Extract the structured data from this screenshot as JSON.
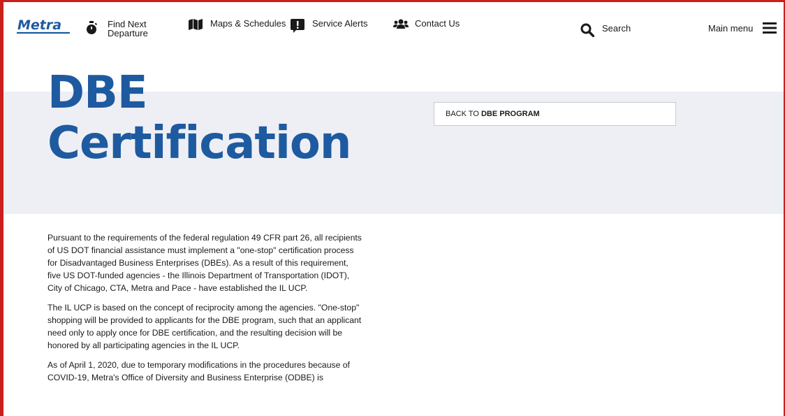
{
  "header": {
    "logo_text": "Metra",
    "nav": {
      "find_line1": "Find Next",
      "find_line2": "Departure",
      "maps": "Maps & Schedules",
      "alerts": "Service Alerts",
      "contact": "Contact Us",
      "search": "Search",
      "main_menu": "Main menu"
    }
  },
  "page": {
    "title_line1": "DBE",
    "title_line2": "Certification",
    "back_prefix": "BACK TO",
    "back_target": "DBE PROGRAM"
  },
  "content": {
    "paragraphs": [
      "Pursuant to the requirements of the federal regulation 49 CFR part 26, all recipients of US DOT financial assistance must implement a \"one-stop\" certification process for Disadvantaged Business Enterprises (DBEs). As a result of this requirement, five US DOT-funded agencies - the Illinois Department of Transportation (IDOT), City of Chicago, CTA, Metra and Pace - have established the IL UCP.",
      "The IL UCP is based on the concept of reciprocity among the agencies. \"One-stop\" shopping will be provided to applicants for the DBE program, such that an applicant need only to apply once for DBE certification, and the resulting decision will be honored by all participating agencies in the IL UCP.",
      "As of April 1, 2020, due to temporary modifications in the procedures because of COVID-19, Metra's Office of Diversity and Business Enterprise (ODBE) is"
    ]
  },
  "colors": {
    "brand_blue": "#1e5aa0",
    "frame_red": "#c9201c",
    "band_gray": "#eeeff5"
  },
  "icons": [
    "stopwatch-icon",
    "map-icon",
    "alert-icon",
    "users-icon",
    "search-icon",
    "hamburger-icon"
  ]
}
